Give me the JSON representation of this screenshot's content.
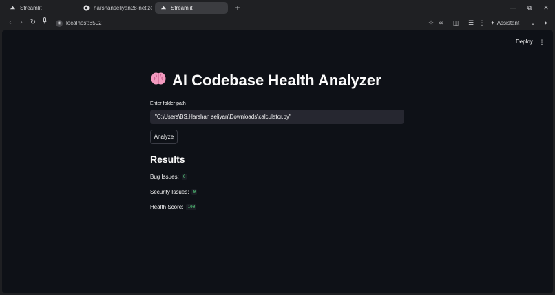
{
  "browser": {
    "tabs": [
      {
        "label": "Streamlit",
        "icon": "streamlit-icon",
        "active": false
      },
      {
        "label": "harshanseliyan28-netizen",
        "icon": "github-icon",
        "active": false
      },
      {
        "label": "Streamlit",
        "icon": "streamlit-icon",
        "active": true
      }
    ],
    "url": "localhost:8502",
    "assistant_label": "Assistant"
  },
  "app": {
    "deploy_label": "Deploy",
    "title_text": "AI Codebase Health Analyzer",
    "title_emoji": "brain-icon",
    "input_label": "Enter folder path",
    "input_value": "\"C:\\Users\\BS.Harshan seliyan\\Downloads\\calculator.py\"",
    "analyze_label": "Analyze",
    "results_heading": "Results",
    "metrics": [
      {
        "label": "Bug Issues:",
        "value": "0"
      },
      {
        "label": "Security Issues:",
        "value": "0"
      },
      {
        "label": "Health Score:",
        "value": "100"
      }
    ],
    "colors": {
      "background": "#0e1117",
      "input_bg": "#262730",
      "code_value": "#5ce488"
    }
  }
}
